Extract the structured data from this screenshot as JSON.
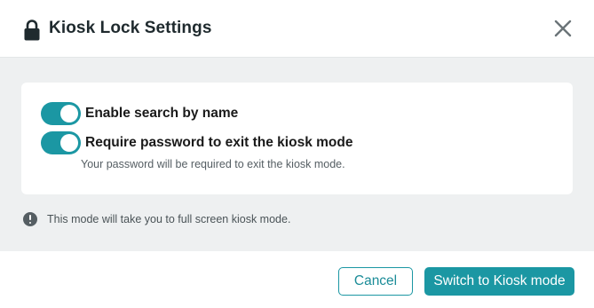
{
  "dialog": {
    "title": "Kiosk Lock Settings",
    "title_icon": "lock-icon",
    "close_icon": "close-icon"
  },
  "settings": {
    "toggles": [
      {
        "label": "Enable search by name",
        "enabled": true
      },
      {
        "label": "Require password to exit the kiosk mode",
        "enabled": true,
        "description": "Your password will be required to exit the kiosk mode."
      }
    ]
  },
  "info": {
    "icon": "info-icon",
    "text": "This mode will take you to full screen kiosk mode."
  },
  "footer": {
    "cancel_label": "Cancel",
    "primary_label": "Switch to Kiosk mode"
  },
  "colors": {
    "accent": "#1b97a3",
    "body_background": "#eef0f1",
    "title_text": "#1f2a2e"
  }
}
